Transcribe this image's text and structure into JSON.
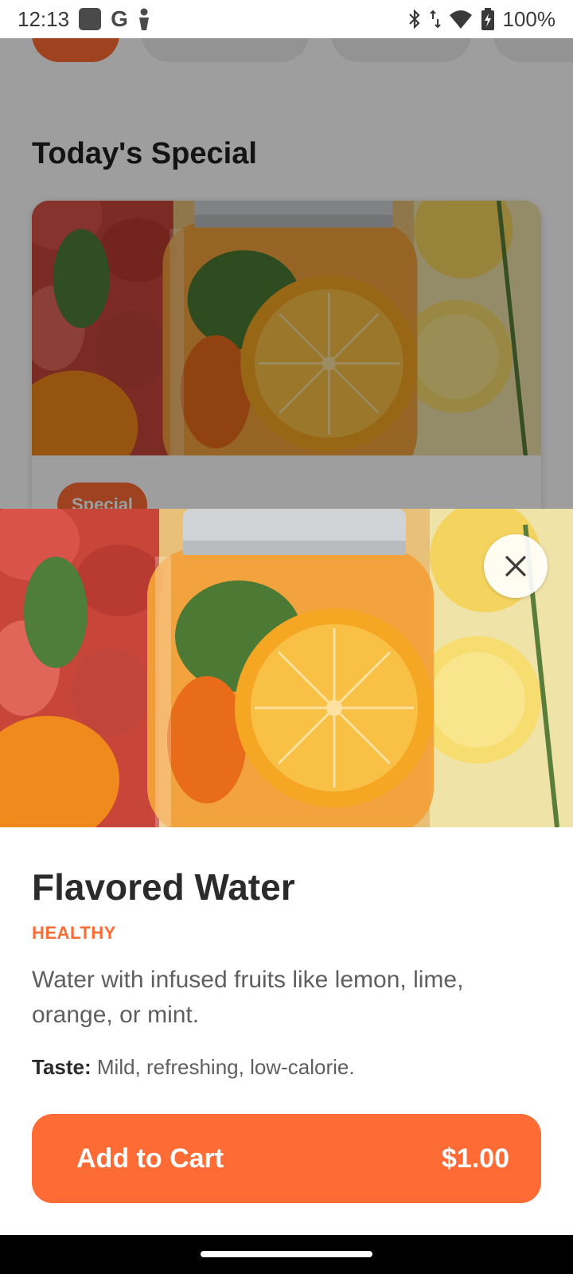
{
  "status_bar": {
    "time": "12:13",
    "battery": "100%",
    "icons": [
      "notification-square-icon",
      "google-icon",
      "person-icon",
      "bluetooth-icon",
      "data-arrows-icon",
      "wifi-icon",
      "battery-charging-icon"
    ]
  },
  "background_page": {
    "section_title": "Today's Special",
    "card_badge": "Special"
  },
  "product": {
    "title": "Flavored Water",
    "category": "HEALTHY",
    "description": "Water with infused fruits like lemon, lime, orange, or mint.",
    "taste_label": "Taste:",
    "taste_value": "Mild, refreshing, low-calorie.",
    "add_to_cart_label": "Add to Cart",
    "price": "$1.00"
  },
  "colors": {
    "accent": "#ff6b35",
    "title_text": "#2b2b2b",
    "body_text": "#5f5f5f"
  }
}
